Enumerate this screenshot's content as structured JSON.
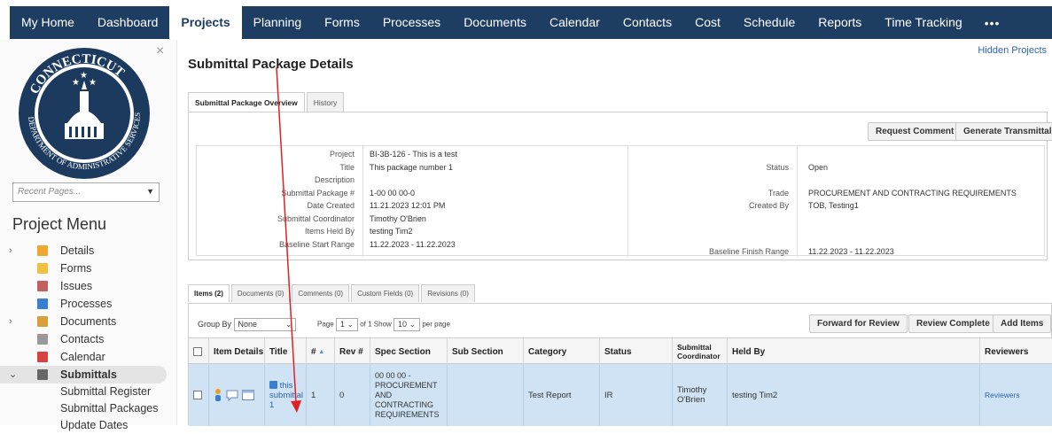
{
  "topnav": {
    "tabs": [
      "My Home",
      "Dashboard",
      "Projects",
      "Planning",
      "Forms",
      "Processes",
      "Documents",
      "Calendar",
      "Contacts",
      "Cost",
      "Schedule",
      "Reports",
      "Time Tracking"
    ],
    "active": "Projects",
    "more": "•••"
  },
  "sidebar": {
    "close": "×",
    "recent_placeholder": "Recent Pages...",
    "title": "Project Menu",
    "items": [
      {
        "label": "Details",
        "expand": "›",
        "color": "#f0a830"
      },
      {
        "label": "Forms",
        "expand": "",
        "color": "#f0c040"
      },
      {
        "label": "Issues",
        "expand": "",
        "color": "#c06060"
      },
      {
        "label": "Processes",
        "expand": "",
        "color": "#3a7fcf"
      },
      {
        "label": "Documents",
        "expand": "›",
        "color": "#d9a03a"
      },
      {
        "label": "Contacts",
        "expand": "",
        "color": "#999999"
      },
      {
        "label": "Calendar",
        "expand": "",
        "color": "#d94040"
      },
      {
        "label": "Submittals",
        "expand": "⌄",
        "color": "#666666"
      }
    ],
    "subitems": [
      "Submittal Register",
      "Submittal Packages",
      "Update Dates"
    ]
  },
  "main": {
    "hidden_projects": "Hidden Projects",
    "title": "Submittal Package Details",
    "tabs": [
      "Submittal Package Overview",
      "History"
    ],
    "buttons": {
      "request_comment": "Request Comment",
      "generate_transmittal": "Generate Transmittal"
    },
    "left_fields": [
      {
        "label": "Project",
        "value": "BI-3B-126 - This is a test"
      },
      {
        "label": "Title",
        "value": "This package number 1"
      },
      {
        "label": "Description",
        "value": ""
      },
      {
        "label": "Submittal Package #",
        "value": "1-00 00 00-0"
      },
      {
        "label": "Date Created",
        "value": "11.21.2023 12:01 PM"
      },
      {
        "label": "Submittal Coordinator",
        "value": "Timothy O'Brien"
      },
      {
        "label": "Items Held By",
        "value": "testing Tim2"
      },
      {
        "label": "Baseline Start Range",
        "value": "11.22.2023 - 11.22.2023"
      }
    ],
    "right_fields": [
      {
        "label": "Status",
        "value": "Open"
      },
      {
        "label": "Trade",
        "value": "PROCUREMENT AND CONTRACTING REQUIREMENTS"
      },
      {
        "label": "Created By",
        "value": "TOB, Testing1"
      },
      {
        "label": "Baseline Finish Range",
        "value": "11.22.2023 - 11.22.2023"
      }
    ]
  },
  "items": {
    "tabs": [
      "Items (2)",
      "Documents (0)",
      "Comments (0)",
      "Custom Fields (0)",
      "Revisions (0)"
    ],
    "group_by_label": "Group By",
    "group_by_value": "None",
    "page_label": "Page",
    "page_value": "1",
    "of_label": "of 1",
    "show_label": "Show",
    "show_value": "10",
    "per_page": "per page",
    "buttons": {
      "forward": "Forward for Review",
      "complete": "Review Complete",
      "add": "Add Items"
    },
    "columns": [
      "Item Details",
      "Title",
      "#",
      "Rev #",
      "Spec Section",
      "Sub Section",
      "Category",
      "Status",
      "Submittal Coordinator",
      "Held By",
      "Reviewers"
    ],
    "sort_indicator": "▲",
    "row": {
      "title": "this submittal 1",
      "num": "1",
      "rev": "0",
      "spec": "00 00 00 - PROCUREMENT AND CONTRACTING REQUIREMENTS",
      "sub": "",
      "category": "Test Report",
      "status": "IR",
      "coordinator": "Timothy O'Brien",
      "held_by": "testing Tim2",
      "reviewers": "Reviewers"
    }
  }
}
